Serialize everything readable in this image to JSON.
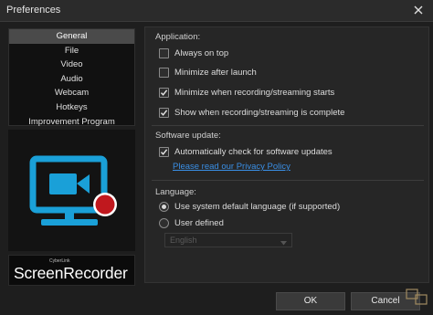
{
  "window": {
    "title": "Preferences"
  },
  "nav": {
    "items": [
      {
        "label": "General",
        "selected": true
      },
      {
        "label": "File",
        "selected": false
      },
      {
        "label": "Video",
        "selected": false
      },
      {
        "label": "Audio",
        "selected": false
      },
      {
        "label": "Webcam",
        "selected": false
      },
      {
        "label": "Hotkeys",
        "selected": false
      },
      {
        "label": "Improvement Program",
        "selected": false
      }
    ]
  },
  "brand": {
    "small": "CyberLink",
    "name": "ScreenRecorder"
  },
  "application": {
    "label": "Application:",
    "options": [
      {
        "label": "Always on top",
        "checked": false
      },
      {
        "label": "Minimize after launch",
        "checked": false
      },
      {
        "label": "Minimize when recording/streaming starts",
        "checked": true
      },
      {
        "label": "Show when recording/streaming is complete",
        "checked": true
      }
    ]
  },
  "software_update": {
    "label": "Software update:",
    "option": {
      "label": "Automatically check for software updates",
      "checked": true
    },
    "link": "Please read our Privacy Policy"
  },
  "language": {
    "label": "Language:",
    "options": [
      {
        "label": "Use system default language (if supported)",
        "selected": true
      },
      {
        "label": "User defined",
        "selected": false
      }
    ],
    "dropdown_value": "English"
  },
  "buttons": {
    "ok": "OK",
    "cancel": "Cancel"
  },
  "colors": {
    "accent_link": "#3a8fe6",
    "logo_blue": "#1aa0d8",
    "record_red": "#c0181e"
  }
}
